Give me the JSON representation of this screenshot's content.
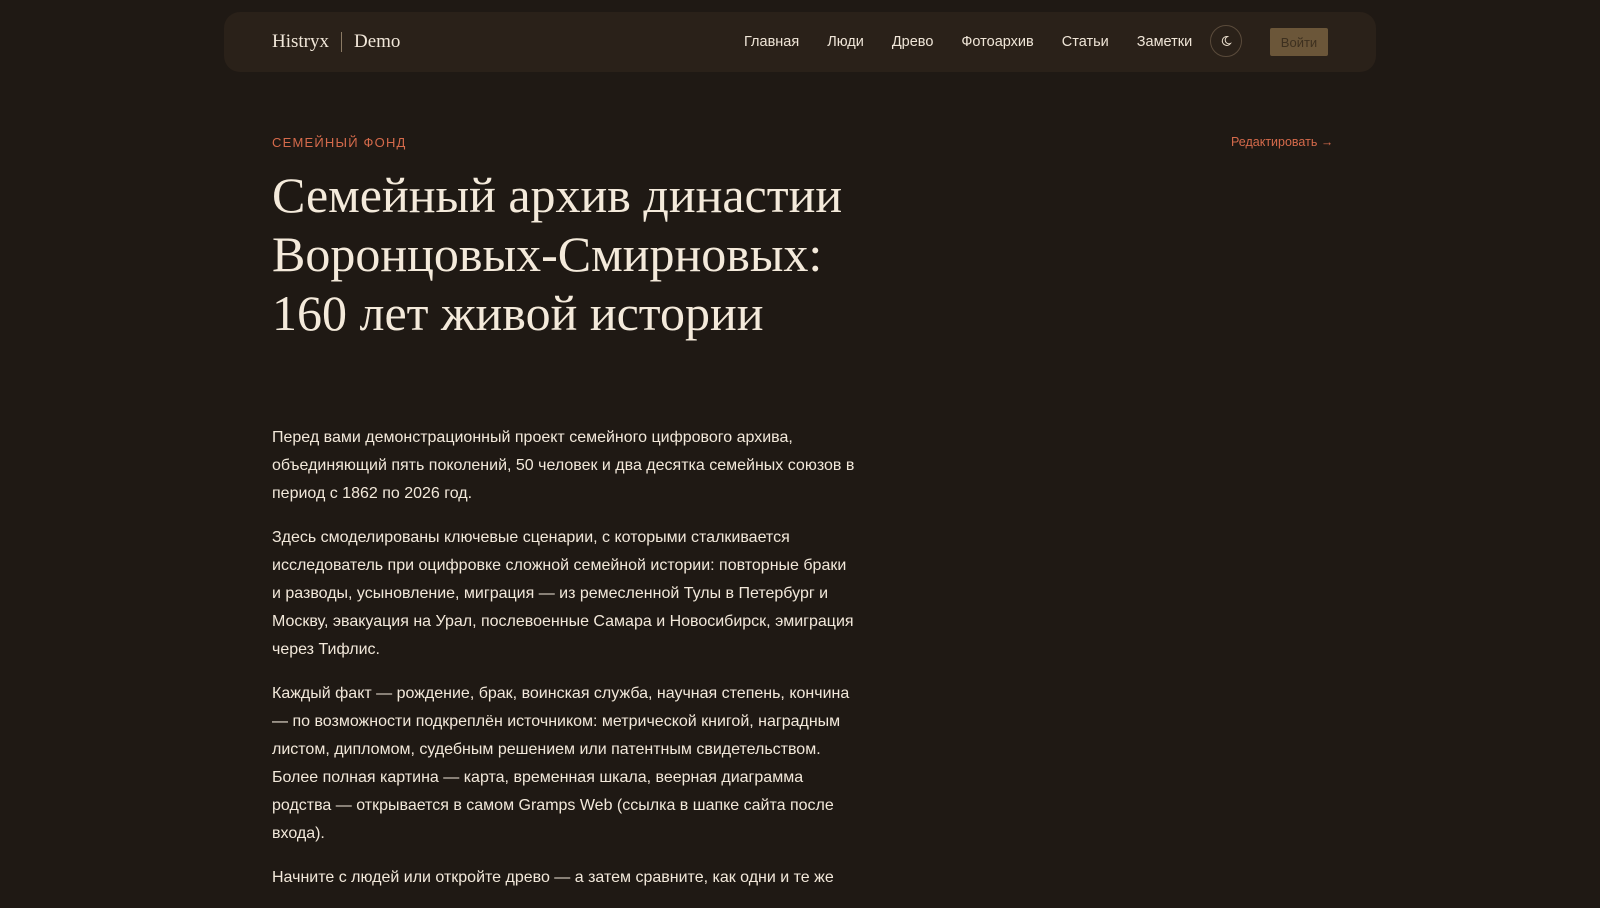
{
  "header": {
    "brand": "Histryx",
    "brand_suffix": "Demo",
    "nav": [
      "Главная",
      "Люди",
      "Древо",
      "Фотоархив",
      "Статьи",
      "Заметки"
    ],
    "theme_icon": "moon-icon",
    "login": "Войти"
  },
  "page": {
    "eyebrow": "СЕМЕЙНЫЙ ФОНД",
    "edit_link": "Редактировать →",
    "title": "Семейный архив династии Воронцовых-Смирновых: 160 лет живой истории",
    "paragraphs": [
      "Перед вами демонстрационный проект семейного цифрового архива, объединяющий пять поколений, 50 человек и два десятка семейных союзов в период с 1862 по 2026 год.",
      "Здесь смоделированы ключевые сценарии, с которыми сталкивается исследователь при оцифровке сложной семейной истории: повторные браки и разводы, усыновление, миграция — из ремесленной Тулы в Петербург и Москву, эвакуация на Урал, послевоенные Самара и Новосибирск, эмиграция через Тифлис.",
      "Каждый факт — рождение, брак, воинская служба, научная степень, кончина — по возможности подкреплён источником: метрической книгой, наградным листом, дипломом, судебным решением или патентным свидетельством. Более полная картина — карта, временная шкала, веерная диаграмма родства — открывается в самом Gramps Web (ссылка в шапке сайта после входа).",
      "Начните с людей или откройте древо — а затем сравните, как одни и те же"
    ]
  },
  "colors": {
    "background": "#1f1914",
    "header_bg": "#2a2119",
    "accent": "#d56a4b",
    "button_bg": "#6b5639"
  }
}
